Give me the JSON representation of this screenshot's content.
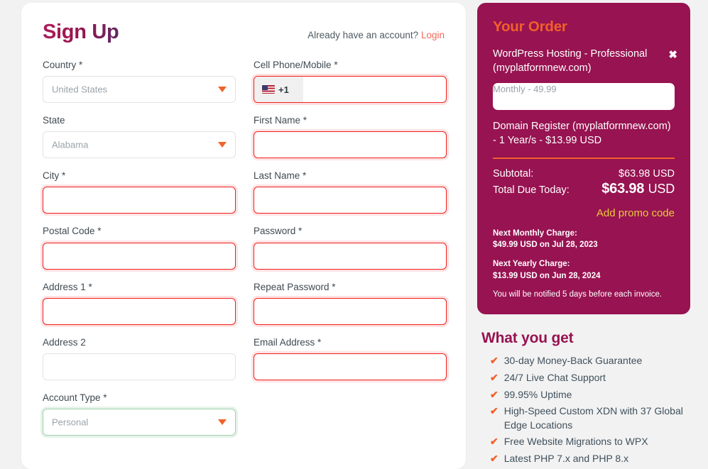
{
  "form": {
    "title": "Sign Up",
    "have_account_text": "Already have an account?",
    "login_label": "Login",
    "fields": {
      "country": {
        "label": "Country *",
        "value": "United States"
      },
      "cell_phone": {
        "label": "Cell Phone/Mobile *",
        "dial_code": "+1",
        "value": ""
      },
      "state": {
        "label": "State",
        "value": "Alabama"
      },
      "first_name": {
        "label": "First Name *",
        "value": ""
      },
      "city": {
        "label": "City *",
        "value": ""
      },
      "last_name": {
        "label": "Last Name *",
        "value": ""
      },
      "postal_code": {
        "label": "Postal Code *",
        "value": ""
      },
      "password": {
        "label": "Password *",
        "value": ""
      },
      "address1": {
        "label": "Address 1 *",
        "value": ""
      },
      "repeat_password": {
        "label": "Repeat Password *",
        "value": ""
      },
      "address2": {
        "label": "Address 2",
        "value": ""
      },
      "email": {
        "label": "Email Address *",
        "value": ""
      },
      "account_type": {
        "label": "Account Type *",
        "value": "Personal"
      }
    }
  },
  "order": {
    "title": "Your Order",
    "close_label": "✖",
    "item_name": "WordPress Hosting - Professional (myplatformnew.com)",
    "billing_cycle": "Monthly - 49.99",
    "domain_line": "Domain Register (myplatformnew.com) - 1 Year/s - $13.99 USD",
    "subtotal_label": "Subtotal:",
    "subtotal_value": "$63.98 USD",
    "total_label": "Total Due Today:",
    "total_symbol": "$",
    "total_amount": "63.98",
    "total_currency": "USD",
    "promo_label": "Add promo code",
    "next_monthly_title": "Next Monthly Charge:",
    "next_monthly_value": "$49.99 USD on Jul 28, 2023",
    "next_yearly_title": "Next Yearly Charge:",
    "next_yearly_value": "$13.99 USD on Jun 28, 2024",
    "invoice_note": "You will be notified 5 days before each invoice."
  },
  "benefits": {
    "title": "What you get",
    "items": [
      "30-day Money-Back Guarantee",
      "24/7 Live Chat Support",
      "99.95% Uptime",
      "High-Speed Custom XDN with 37 Global Edge Locations",
      "Free Website Migrations to WPX",
      "Latest PHP 7.x and PHP 8.x"
    ]
  },
  "colors": {
    "brand_magenta": "#971351",
    "accent_orange": "#f1602b",
    "promo_gold": "#ebc83d",
    "error_red": "#f01f1f",
    "valid_green": "#9ed1ac",
    "login_link": "#f2695b",
    "page_bg": "#f2f2f2"
  }
}
